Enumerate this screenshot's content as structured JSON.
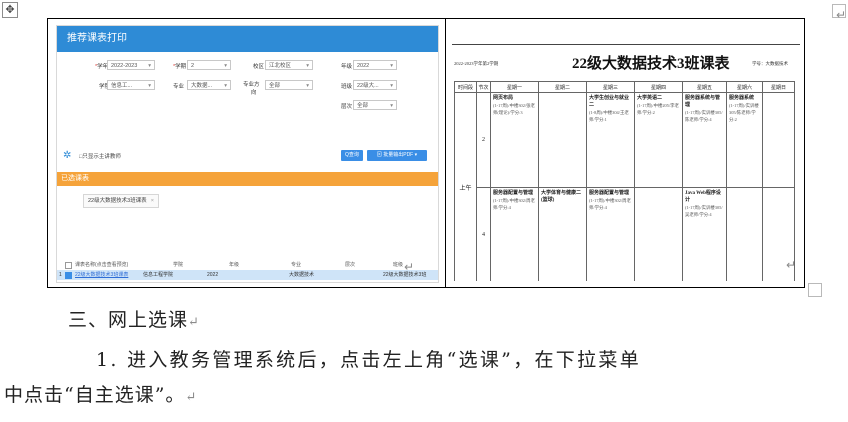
{
  "editor": {
    "move_handle": "✥",
    "para_mark": "↵"
  },
  "screenshot": {
    "title": "推荐课表打印",
    "form": {
      "year_label": "学年",
      "year_value": "2022-2023",
      "term_label": "学期",
      "term_value": "2",
      "campus_label": "校区",
      "campus_value": "江北校区",
      "grade_label": "年级",
      "grade_value": "2022",
      "college_label": "学院",
      "college_value": "信息工...",
      "major_label": "专业",
      "major_value": "大数据...",
      "direction_label_1": "专业方",
      "direction_label_2": "向",
      "direction_value": "全部",
      "class_label": "班级",
      "class_value": "22级大...",
      "level_label": "层次",
      "level_value": "全部"
    },
    "only_checkbox_label": "□只显示主讲教师",
    "query_button": "Q查询",
    "pdf_button": "⊠ 批量输出PDF ▾",
    "section_title": "已选课表",
    "chip_label": "22级大数据技术3班课表",
    "chip_close": "×",
    "table_headers": [
      "课表名称(点击查看预览)",
      "学院",
      "年级",
      "专业",
      "层次",
      "班级"
    ],
    "table_row": {
      "index": "1",
      "name": "22级大数据技术3班课表",
      "college": "信息工程学院",
      "grade": "2022",
      "major": "大数据技术",
      "level": "",
      "class": "22级大数据技术3班"
    }
  },
  "timetable": {
    "top_left": "2022-2023学年第2学期",
    "title": "22级大数据技术3班课表",
    "top_right": "学号：大数据技术",
    "headers": [
      "时间段",
      "节次",
      "星期一",
      "星期二",
      "星期三",
      "星期四",
      "星期五",
      "星期六",
      "星期日"
    ],
    "am_label": "上午",
    "rows": [
      {
        "period": "2",
        "cells": [
          {
            "title": "网页布局",
            "detail": "(1-17周)/中楼302/张老师(理论)/学分:3"
          },
          {
            "title": "",
            "detail": ""
          },
          {
            "title": "大学生创业与就业二",
            "detail": "(1-8周)/中楼304/王老师/学分:1"
          },
          {
            "title": "大学英语二",
            "detail": "(1-17周)/中楼205/李老师/学分:2"
          },
          {
            "title": "服务器系统与管理",
            "detail": "(1-17周)/实训楼305/陈老师/学分:4"
          },
          {
            "title": "服务器系统",
            "detail": "(1-17周)/实训楼305/陈老师/学分:2"
          },
          {
            "title": "",
            "detail": ""
          }
        ]
      },
      {
        "period": "4",
        "cells": [
          {
            "title": "服务器配置与管理",
            "detail": "(1-17周)/中楼302/周老师/学分:4"
          },
          {
            "title": "大学体育与健康二(篮球)",
            "detail": ""
          },
          {
            "title": "服务器配置与管理",
            "detail": "(1-17周)/中楼302/周老师/学分:4"
          },
          {
            "title": "",
            "detail": ""
          },
          {
            "title": "Java Web程序设计",
            "detail": "(1-17周)/实训楼305/吴老师/学分:4"
          },
          {
            "title": "",
            "detail": ""
          },
          {
            "title": "",
            "detail": ""
          }
        ]
      }
    ]
  },
  "body": {
    "section_heading": "三、网上选课",
    "paragraph_line1": "1. 进入教务管理系统后，点击左上角“选课”，在下拉菜单",
    "paragraph_line2": "中点击“自主选课”。"
  }
}
